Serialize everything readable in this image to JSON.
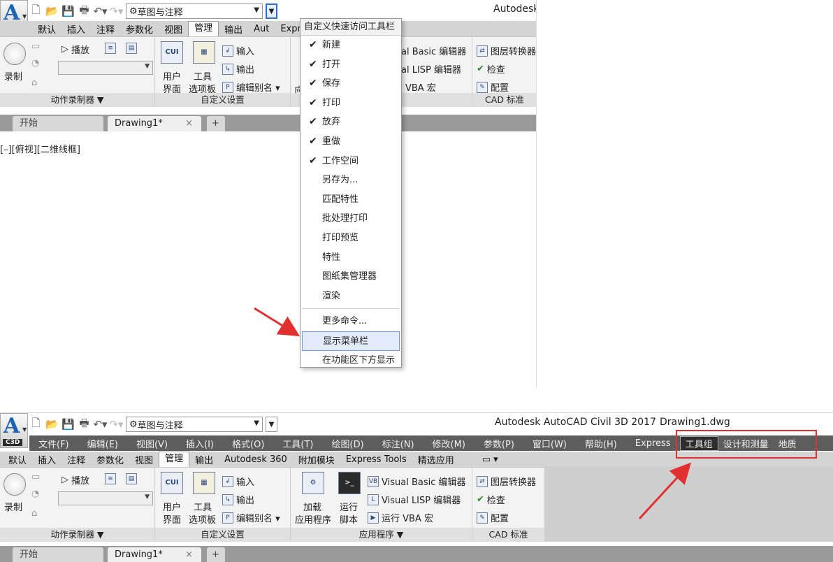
{
  "top": {
    "app_badge": "C3D",
    "workspace": "草图与注释",
    "title_partial": "Autodesk",
    "tabs": [
      "默认",
      "插入",
      "注释",
      "参数化",
      "视图",
      "管理",
      "输出",
      "Aut",
      "Express Tools",
      "精选应用"
    ],
    "active_tab": "管理",
    "viewport_label": "[–][俯视][二维线框]"
  },
  "ribbon": {
    "recorder": {
      "record": "录制",
      "play": "播放",
      "label": "动作录制器 ▼"
    },
    "custom": {
      "user_ui_1": "用户",
      "user_ui_2": "界面",
      "tool_1": "工具",
      "tool_2": "选项板",
      "import": "输入",
      "export": "输出",
      "alias": "编辑别名 ▾",
      "label": "自定义设置"
    },
    "apps": {
      "load_1": "加载",
      "load_2": "应用程序",
      "run_1": "运行",
      "run_2": "脚本",
      "vb": "Visual Basic 编辑器",
      "lisp": "Visual LISP 编辑器",
      "vba": "运行 VBA 宏",
      "label": "应用程序 ▼",
      "vb_partial": "al Basic 编辑器",
      "lisp_partial": "al LISP 编辑器",
      "vba_partial": "VBA 宏",
      "prefix_partial": "应"
    },
    "cad": {
      "layer": "图层转换器",
      "check": "检查",
      "config": "配置",
      "label": "CAD 标准"
    }
  },
  "doctabs": {
    "start": "开始",
    "drawing": "Drawing1*",
    "close": "×",
    "add": "+"
  },
  "dropdown": {
    "header": "自定义快速访问工具栏",
    "items": [
      {
        "label": "新建",
        "checked": "✔"
      },
      {
        "label": "打开",
        "checked": "✔"
      },
      {
        "label": "保存",
        "checked": "✔"
      },
      {
        "label": "打印",
        "checked": "✔"
      },
      {
        "label": "放弃",
        "checked": "✔"
      },
      {
        "label": "重做",
        "checked": "✔"
      },
      {
        "label": "工作空间",
        "checked": "✔"
      },
      {
        "label": "另存为...",
        "checked": ""
      },
      {
        "label": "匹配特性",
        "checked": ""
      },
      {
        "label": "批处理打印",
        "checked": ""
      },
      {
        "label": "打印预览",
        "checked": ""
      },
      {
        "label": "特性",
        "checked": ""
      },
      {
        "label": "图纸集管理器",
        "checked": ""
      },
      {
        "label": "渲染",
        "checked": ""
      }
    ],
    "more": "更多命令...",
    "show_menubar": "显示菜单栏",
    "below_ribbon": "在功能区下方显示"
  },
  "bottom": {
    "title": "Autodesk AutoCAD Civil 3D 2017",
    "file": "Drawing1.dwg",
    "menus": [
      "文件(F)",
      "编辑(E)",
      "视图(V)",
      "插入(I)",
      "格式(O)",
      "工具(T)",
      "绘图(D)",
      "标注(N)",
      "修改(M)",
      "参数(P)",
      "窗口(W)",
      "帮助(H)",
      "Express"
    ],
    "menus_highlight": [
      "工具组",
      "设计和测量",
      "地质"
    ],
    "tabs": [
      "默认",
      "插入",
      "注释",
      "参数化",
      "视图",
      "管理",
      "输出",
      "Autodesk 360",
      "附加模块",
      "Express Tools",
      "精选应用"
    ],
    "tab_extra": "▭ ▾"
  },
  "colors": {
    "accent": "#2e6bd8",
    "annotation": "#e23030",
    "menubar": "#5d5d5d"
  }
}
